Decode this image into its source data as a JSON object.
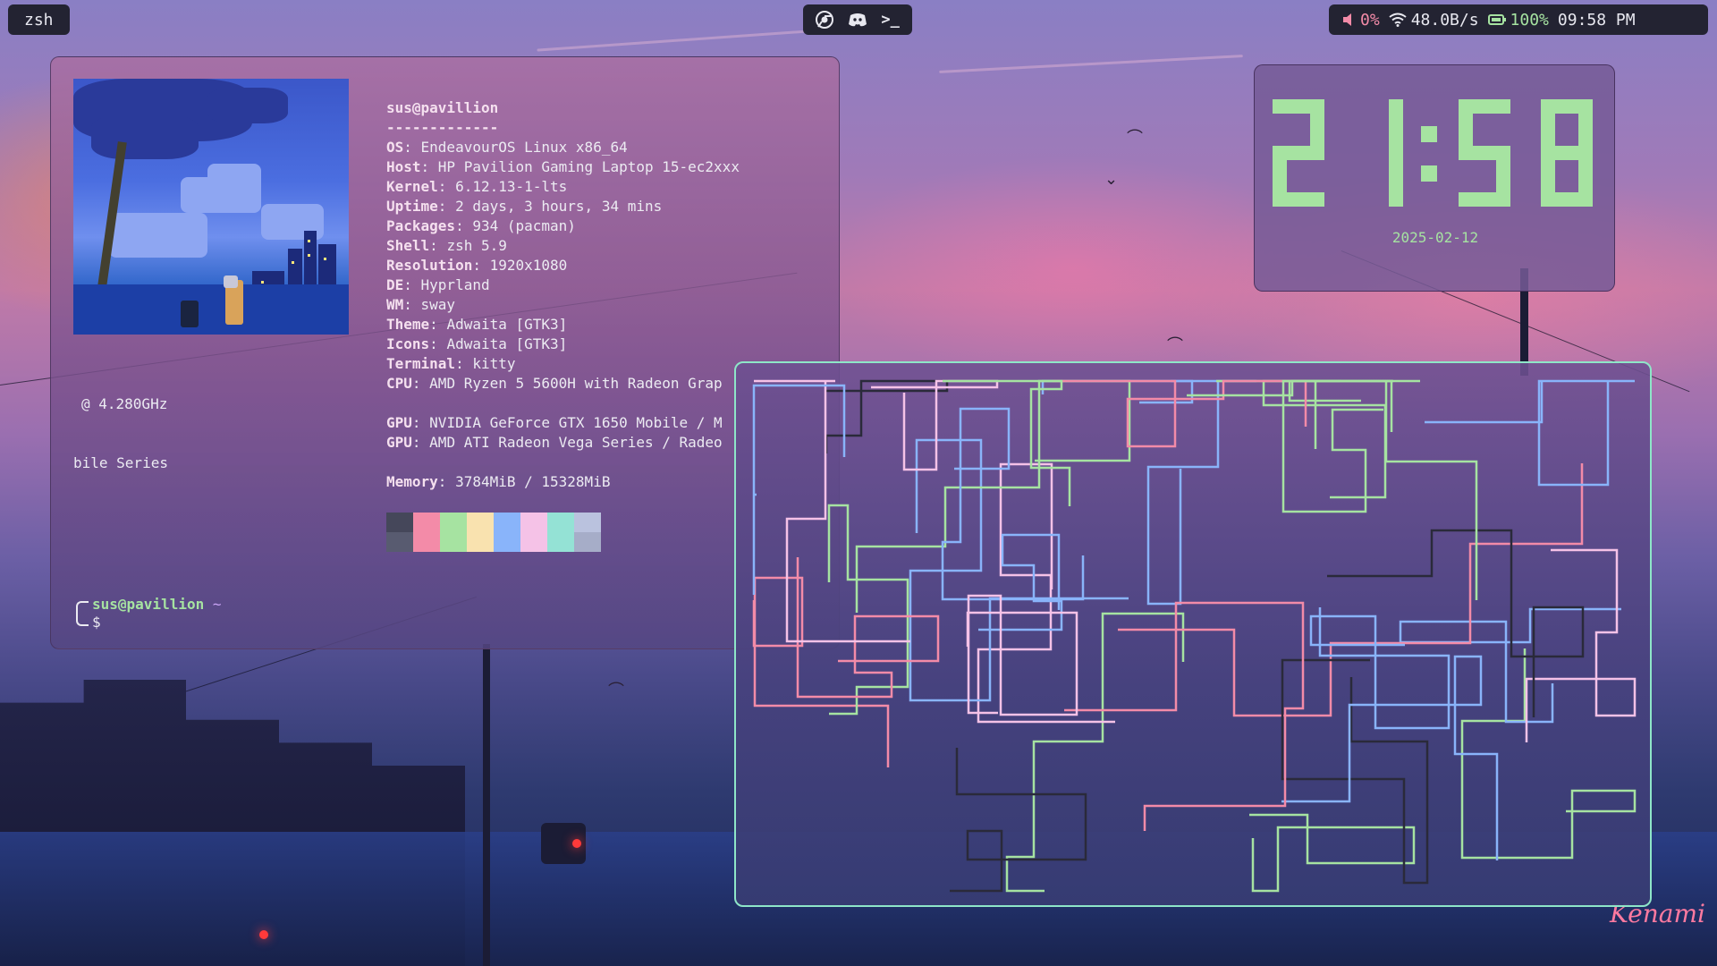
{
  "topbar": {
    "workspace_label": "zsh",
    "apps": [
      {
        "icon": "chrome-icon"
      },
      {
        "icon": "discord-icon"
      },
      {
        "icon": "terminal-icon",
        "glyph": ">_"
      }
    ],
    "volume": "0%",
    "network": "48.0B/s",
    "battery": "100%",
    "time": "09:58 PM"
  },
  "terminal": {
    "info_header": "sus@pavillion",
    "separator": "-------------",
    "info": [
      {
        "key": "OS",
        "value": "EndeavourOS Linux x86_64"
      },
      {
        "key": "Host",
        "value": "HP Pavilion Gaming Laptop 15-ec2xxx"
      },
      {
        "key": "Kernel",
        "value": "6.12.13-1-lts"
      },
      {
        "key": "Uptime",
        "value": "2 days, 3 hours, 34 mins"
      },
      {
        "key": "Packages",
        "value": "934 (pacman)"
      },
      {
        "key": "Shell",
        "value": "zsh 5.9"
      },
      {
        "key": "Resolution",
        "value": "1920x1080"
      },
      {
        "key": "DE",
        "value": "Hyprland"
      },
      {
        "key": "WM",
        "value": "sway"
      },
      {
        "key": "Theme",
        "value": "Adwaita [GTK3]"
      },
      {
        "key": "Icons",
        "value": "Adwaita [GTK3]"
      },
      {
        "key": "Terminal",
        "value": "kitty"
      },
      {
        "key": "CPU",
        "value": "AMD Ryzen 5 5600H with Radeon Grap"
      },
      {
        "key": "GPU",
        "value": "NVIDIA GeForce GTX 1650 Mobile / M"
      },
      {
        "key": "GPU",
        "value": "AMD ATI Radeon Vega Series / Radeo"
      },
      {
        "key": "Memory",
        "value": "3784MiB / 15328MiB"
      }
    ],
    "overflow_cpu": "@ 4.280GHz",
    "overflow_gpu": "bile Series",
    "palette": [
      {
        "top": "#45475a",
        "bottom": "#585b70"
      },
      {
        "top": "#f38ba8",
        "bottom": "#f38ba8"
      },
      {
        "top": "#a6e3a1",
        "bottom": "#a6e3a1"
      },
      {
        "top": "#f9e2af",
        "bottom": "#f9e2af"
      },
      {
        "top": "#89b4fa",
        "bottom": "#89b4fa"
      },
      {
        "top": "#f5c2e7",
        "bottom": "#f5c2e7"
      },
      {
        "top": "#94e2d5",
        "bottom": "#94e2d5"
      },
      {
        "top": "#bac2de",
        "bottom": "#a6adc8"
      }
    ],
    "prompt_user": "sus@pavillion",
    "prompt_dir": "~",
    "prompt_symbol": "$"
  },
  "clock_widget": {
    "time": "21:58",
    "date": "2025-02-12",
    "color": "#a6e3a1"
  },
  "wallpaper": {
    "signature": "Kenami"
  },
  "colors": {
    "pipes_green": "#a6e3a1",
    "pipes_blue": "#89b4fa",
    "pipes_pink": "#f38ba8",
    "pipes_lavender": "#f5c2e7",
    "pipes_dark": "#2a2a3a",
    "window_border": "#8ee6c8"
  }
}
